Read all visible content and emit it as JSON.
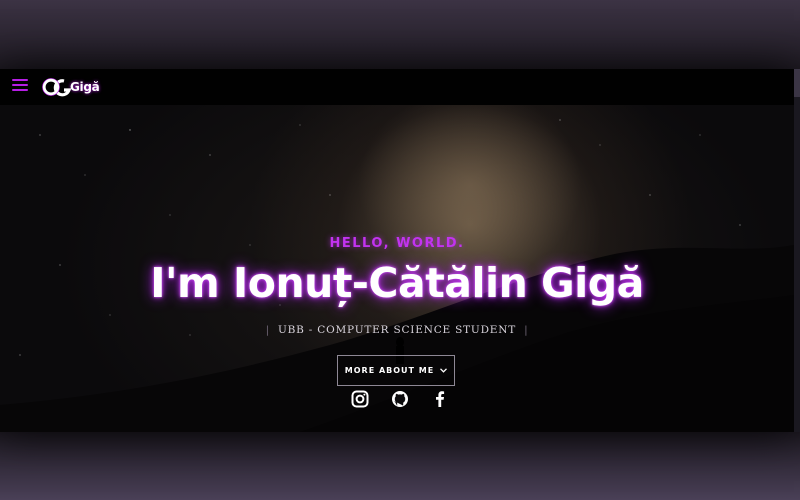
{
  "navbar": {
    "logo_text": "Gigă"
  },
  "hero": {
    "greeting": "HELLO, WORLD.",
    "title": "I'm Ionuț-Cătălin Gigă",
    "subtitle": "UBB - COMPUTER SCIENCE STUDENT",
    "subtitle_divider": "|",
    "more_button": "MORE ABOUT ME",
    "more_icon": "chevron-down-icon"
  },
  "social": {
    "icons": [
      "instagram-icon",
      "github-icon",
      "facebook-icon"
    ]
  },
  "colors": {
    "accent": "#c233f0",
    "navbar": "#010101",
    "background": "#0b0a0c"
  }
}
